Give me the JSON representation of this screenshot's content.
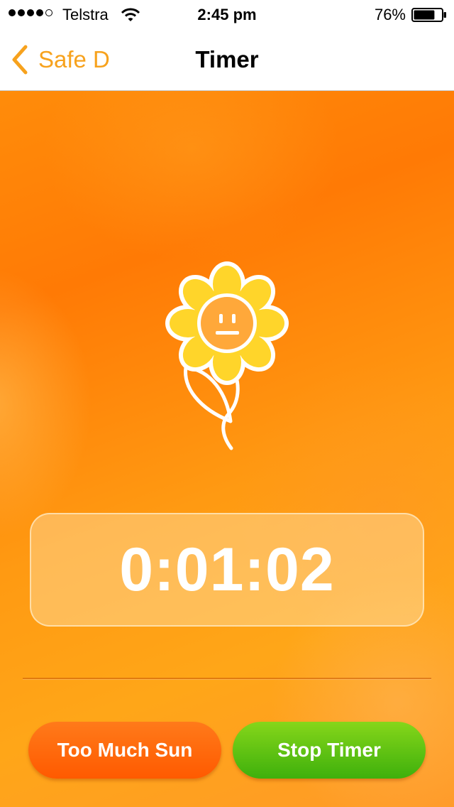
{
  "status_bar": {
    "carrier": "Telstra",
    "time": "2:45 pm",
    "battery_percent": "76%",
    "battery_level": 0.76,
    "signal_bars_filled": 4,
    "signal_bars_total": 5
  },
  "nav": {
    "back_label": "Safe D",
    "title": "Timer"
  },
  "timer": {
    "elapsed": "0:01:02"
  },
  "buttons": {
    "too_much_sun": "Too Much Sun",
    "stop_timer": "Stop Timer"
  },
  "colors": {
    "accent": "#f7a21d",
    "background_orange": "#ff8c0a",
    "button_orange": "#ff5a00",
    "button_green": "#3eb00c"
  },
  "icons": {
    "back": "chevron-left-icon",
    "flower": "neutral-face-flower-icon",
    "wifi": "wifi-icon",
    "battery": "battery-icon"
  }
}
